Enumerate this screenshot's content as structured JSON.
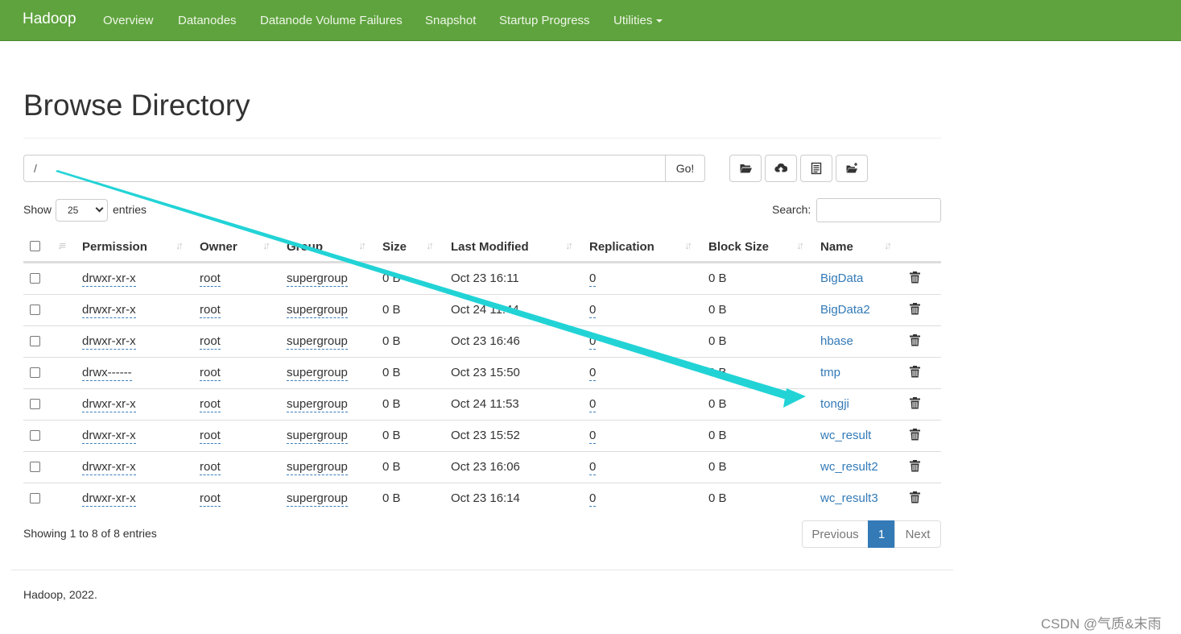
{
  "navbar": {
    "brand": "Hadoop",
    "items": [
      "Overview",
      "Datanodes",
      "Datanode Volume Failures",
      "Snapshot",
      "Startup Progress",
      "Utilities"
    ]
  },
  "page": {
    "title": "Browse Directory",
    "path_value": "/",
    "go_label": "Go!",
    "show_label": "Show",
    "entries_value": "25",
    "entries_label": "entries",
    "search_label": "Search:"
  },
  "table": {
    "columns": [
      "Permission",
      "Owner",
      "Group",
      "Size",
      "Last Modified",
      "Replication",
      "Block Size",
      "Name"
    ],
    "rows": [
      {
        "permission": "drwxr-xr-x",
        "owner": "root",
        "group": "supergroup",
        "size": "0 B",
        "modified": "Oct 23 16:11",
        "replication": "0",
        "block_size": "0 B",
        "name": "BigData"
      },
      {
        "permission": "drwxr-xr-x",
        "owner": "root",
        "group": "supergroup",
        "size": "0 B",
        "modified": "Oct 24 11:44",
        "replication": "0",
        "block_size": "0 B",
        "name": "BigData2"
      },
      {
        "permission": "drwxr-xr-x",
        "owner": "root",
        "group": "supergroup",
        "size": "0 B",
        "modified": "Oct 23 16:46",
        "replication": "0",
        "block_size": "0 B",
        "name": "hbase"
      },
      {
        "permission": "drwx------",
        "owner": "root",
        "group": "supergroup",
        "size": "0 B",
        "modified": "Oct 23 15:50",
        "replication": "0",
        "block_size": "0 B",
        "name": "tmp"
      },
      {
        "permission": "drwxr-xr-x",
        "owner": "root",
        "group": "supergroup",
        "size": "0 B",
        "modified": "Oct 24 11:53",
        "replication": "0",
        "block_size": "0 B",
        "name": "tongji"
      },
      {
        "permission": "drwxr-xr-x",
        "owner": "root",
        "group": "supergroup",
        "size": "0 B",
        "modified": "Oct 23 15:52",
        "replication": "0",
        "block_size": "0 B",
        "name": "wc_result"
      },
      {
        "permission": "drwxr-xr-x",
        "owner": "root",
        "group": "supergroup",
        "size": "0 B",
        "modified": "Oct 23 16:06",
        "replication": "0",
        "block_size": "0 B",
        "name": "wc_result2"
      },
      {
        "permission": "drwxr-xr-x",
        "owner": "root",
        "group": "supergroup",
        "size": "0 B",
        "modified": "Oct 23 16:14",
        "replication": "0",
        "block_size": "0 B",
        "name": "wc_result3"
      }
    ]
  },
  "pagination": {
    "info": "Showing 1 to 8 of 8 entries",
    "previous": "Previous",
    "current": "1",
    "next": "Next"
  },
  "footer": {
    "text": "Hadoop, 2022."
  },
  "watermark": "CSDN @气质&末雨",
  "colors": {
    "navbar": "#5fa33e",
    "link": "#337ab7",
    "annotation_arrow": "#22d3d6"
  },
  "icons": [
    "folder-open-icon",
    "upload-icon",
    "list-icon",
    "new-folder-icon",
    "trash-icon",
    "sort-icon"
  ]
}
